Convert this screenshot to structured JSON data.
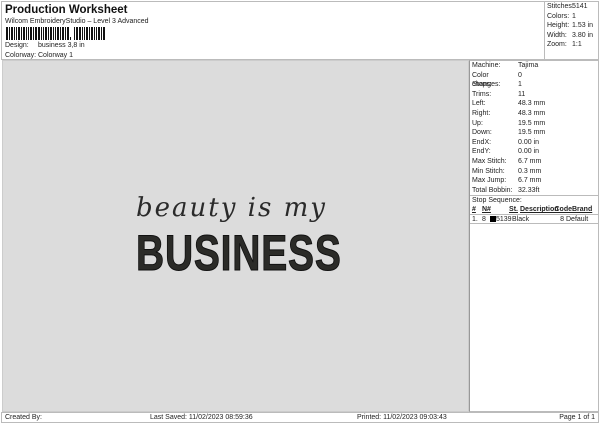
{
  "header": {
    "title": "Production Worksheet",
    "subtitle": "Wilcom EmbroideryStudio – Level 3 Advanced",
    "design_label": "Design:",
    "design_value": "business 3,8 in",
    "colorway_label": "Colorway:",
    "colorway_value": "Colorway 1"
  },
  "summary": [
    {
      "k": "Stitches:",
      "v": "5141"
    },
    {
      "k": "Colors:",
      "v": "1"
    },
    {
      "k": "Height:",
      "v": "1.53 in"
    },
    {
      "k": "Width:",
      "v": "3.80 in"
    },
    {
      "k": "Zoom:",
      "v": "1:1"
    }
  ],
  "design": {
    "line1": "beauty is my",
    "line2": "BUSINESS",
    "thread_color": "#2b2b28"
  },
  "details": [
    {
      "k": "Machine:",
      "v": "Tajima"
    },
    {
      "k": "Color changes:",
      "v": "0"
    },
    {
      "k": "Stops:",
      "v": "1"
    },
    {
      "k": "Trims:",
      "v": "11"
    },
    {
      "k": "Left:",
      "v": "48.3 mm"
    },
    {
      "k": "Right:",
      "v": "48.3 mm"
    },
    {
      "k": "Up:",
      "v": "19.5 mm"
    },
    {
      "k": "Down:",
      "v": "19.5 mm"
    },
    {
      "k": "EndX:",
      "v": "0.00 in"
    },
    {
      "k": "EndY:",
      "v": "0.00 in"
    },
    {
      "k": "Max Stitch:",
      "v": "6.7 mm"
    },
    {
      "k": "Min Stitch:",
      "v": "0.3 mm"
    },
    {
      "k": "Max Jump:",
      "v": "6.7 mm"
    },
    {
      "k": "Total Bobbin:",
      "v": "32.33ft"
    }
  ],
  "stop_sequence": {
    "title": "Stop Sequence:",
    "headers": [
      "#",
      "N#",
      "St.",
      "Description",
      "Code",
      "Brand"
    ],
    "rows": [
      {
        "num": "1.",
        "n": "8",
        "st": "5139",
        "desc": "Black",
        "code": "8",
        "brand": "Default",
        "color": "#000000"
      }
    ]
  },
  "footer": {
    "created": "Created By:",
    "saved": "Last Saved: 11/02/2023 08:59:36",
    "printed": "Printed: 11/02/2023 09:03:43",
    "page": "Page 1 of 1"
  }
}
